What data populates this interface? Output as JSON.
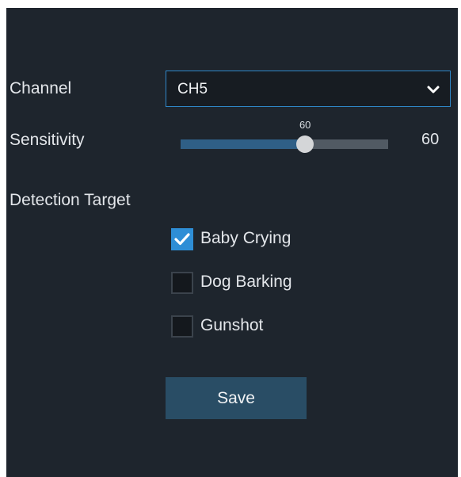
{
  "form": {
    "channel_label": "Channel",
    "channel_value": "CH5",
    "sensitivity_label": "Sensitivity",
    "sensitivity_value": 60,
    "sensitivity_min": 0,
    "sensitivity_max": 100,
    "sensitivity_display": "60",
    "detection_target_label": "Detection Target",
    "targets": [
      {
        "label": "Baby Crying",
        "checked": true
      },
      {
        "label": "Dog Barking",
        "checked": false
      },
      {
        "label": "Gunshot",
        "checked": false
      }
    ],
    "save_label": "Save"
  },
  "icons": {
    "chevron": "chevron-down-icon",
    "check": "checkmark-icon"
  },
  "colors": {
    "panel_bg": "#1e252d",
    "accent": "#2e8ed6",
    "button_bg": "#294d65",
    "slider_fill": "#2f5f86"
  }
}
